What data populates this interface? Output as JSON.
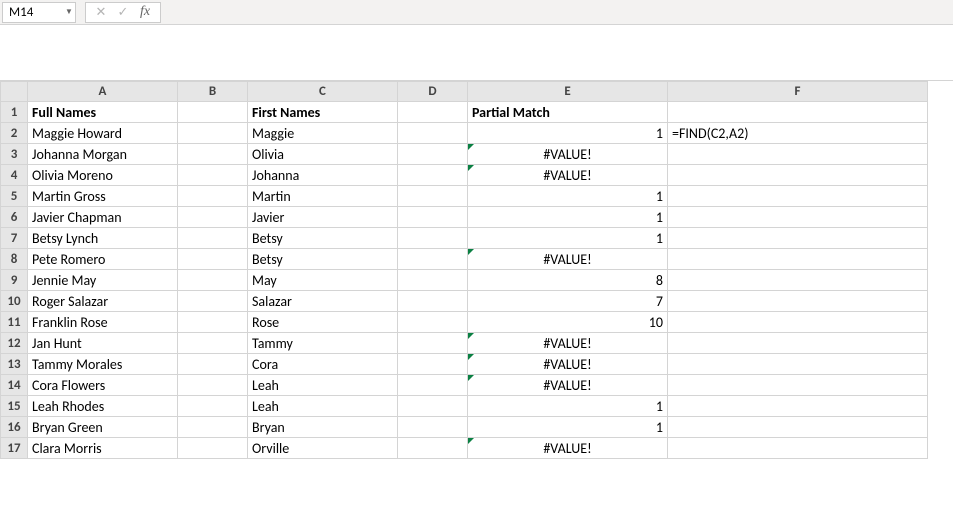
{
  "name_box": "M14",
  "formula_input": "",
  "fx_label": "fx",
  "cancel_glyph": "✕",
  "enter_glyph": "✓",
  "dropdown_glyph": "▼",
  "columns": [
    "A",
    "B",
    "C",
    "D",
    "E",
    "F"
  ],
  "rows": [
    "1",
    "2",
    "3",
    "4",
    "5",
    "6",
    "7",
    "8",
    "9",
    "10",
    "11",
    "12",
    "13",
    "14",
    "15",
    "16",
    "17"
  ],
  "headers": {
    "A": "Full Names",
    "C": "First Names",
    "E": "Partial Match"
  },
  "data": [
    {
      "full": "Maggie Howard",
      "first": "Maggie",
      "e": "1",
      "e_align": "right",
      "err": false
    },
    {
      "full": "Johanna Morgan",
      "first": "Olivia",
      "e": "#VALUE!",
      "e_align": "center",
      "err": true
    },
    {
      "full": "Olivia Moreno",
      "first": "Johanna",
      "e": "#VALUE!",
      "e_align": "center",
      "err": true
    },
    {
      "full": "Martin Gross",
      "first": "Martin",
      "e": "1",
      "e_align": "right",
      "err": false
    },
    {
      "full": "Javier Chapman",
      "first": "Javier",
      "e": "1",
      "e_align": "right",
      "err": false
    },
    {
      "full": "Betsy Lynch",
      "first": "Betsy",
      "e": "1",
      "e_align": "right",
      "err": false
    },
    {
      "full": "Pete Romero",
      "first": "Betsy",
      "e": "#VALUE!",
      "e_align": "center",
      "err": true
    },
    {
      "full": "Jennie May",
      "first": "May",
      "e": "8",
      "e_align": "right",
      "err": false
    },
    {
      "full": "Roger Salazar",
      "first": "Salazar",
      "e": "7",
      "e_align": "right",
      "err": false
    },
    {
      "full": "Franklin Rose",
      "first": "Rose",
      "e": "10",
      "e_align": "right",
      "err": false
    },
    {
      "full": "Jan Hunt",
      "first": "Tammy",
      "e": "#VALUE!",
      "e_align": "center",
      "err": true
    },
    {
      "full": "Tammy Morales",
      "first": "Cora",
      "e": "#VALUE!",
      "e_align": "center",
      "err": true
    },
    {
      "full": "Cora Flowers",
      "first": "Leah",
      "e": "#VALUE!",
      "e_align": "center",
      "err": true
    },
    {
      "full": "Leah Rhodes",
      "first": "Leah",
      "e": "1",
      "e_align": "right",
      "err": false
    },
    {
      "full": "Bryan Green",
      "first": "Bryan",
      "e": "1",
      "e_align": "right",
      "err": false
    },
    {
      "full": "Clara Morris",
      "first": "Orville",
      "e": "#VALUE!",
      "e_align": "center",
      "err": true
    }
  ],
  "annotation_formula": "=FIND(C2,A2)"
}
